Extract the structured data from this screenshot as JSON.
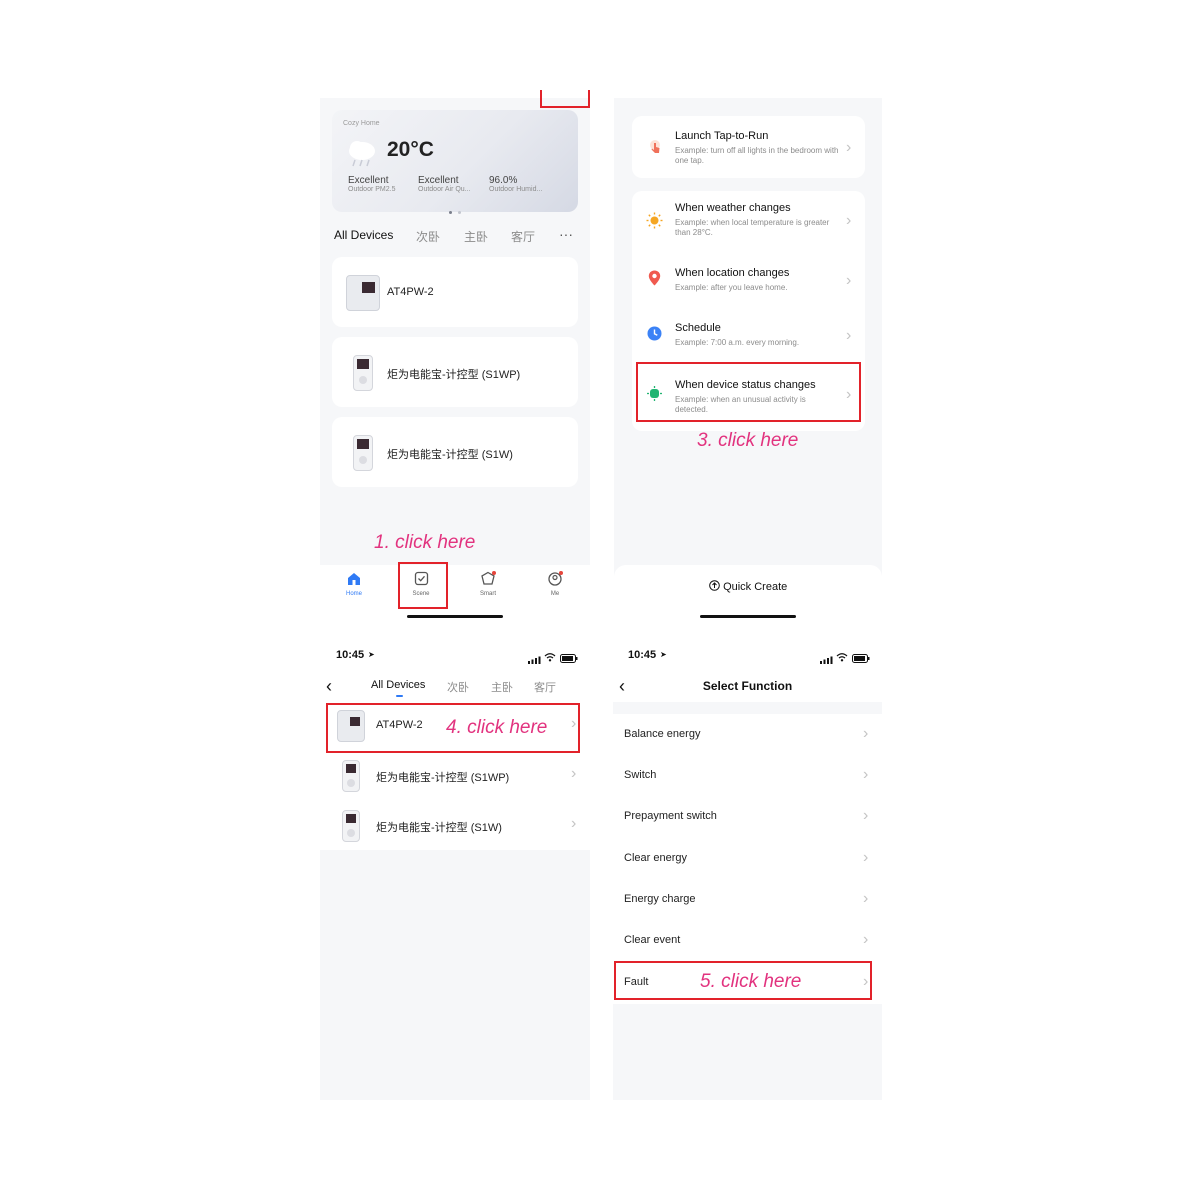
{
  "panel1": {
    "home_name": "Cozy Home",
    "temperature": "20°C",
    "stats": [
      {
        "value": "Excellent",
        "label": "Outdoor PM2.5"
      },
      {
        "value": "Excellent",
        "label": "Outdoor Air Qu..."
      },
      {
        "value": "96.0%",
        "label": "Outdoor Humid..."
      }
    ],
    "tabs": [
      "All Devices",
      "次卧",
      "主卧",
      "客厅"
    ],
    "more": "···",
    "devices": [
      "AT4PW-2",
      "炬为电能宝-计控型 (S1WP)",
      "炬为电能宝-计控型 (S1W)"
    ],
    "nav": [
      {
        "label": "Home",
        "icon": "home-icon"
      },
      {
        "label": "Scene",
        "icon": "scene-icon"
      },
      {
        "label": "Smart",
        "icon": "smart-icon"
      },
      {
        "label": "Me",
        "icon": "me-icon"
      }
    ],
    "annotation": "1. click here"
  },
  "panel2": {
    "launch": {
      "title": "Launch Tap-to-Run",
      "desc": "Example: turn off all lights in the bedroom with one tap.",
      "icon": "tap-icon"
    },
    "conditions": [
      {
        "title": "When weather changes",
        "desc": "Example: when local temperature is greater than 28°C.",
        "icon": "sun-icon",
        "color": "#f5a623"
      },
      {
        "title": "When location changes",
        "desc": "Example: after you leave home.",
        "icon": "location-pin-icon",
        "color": "#f05a4f"
      },
      {
        "title": "Schedule",
        "desc": "Example: 7:00 a.m. every morning.",
        "icon": "clock-icon",
        "color": "#3b82f6"
      },
      {
        "title": "When device status changes",
        "desc": "Example: when an unusual activity is detected.",
        "icon": "device-status-icon",
        "color": "#22b573"
      }
    ],
    "annotation": "3. click here",
    "quick_create": "Quick Create"
  },
  "panel3": {
    "time": "10:45",
    "tabs": [
      "All Devices",
      "次卧",
      "主卧",
      "客厅"
    ],
    "devices": [
      "AT4PW-2",
      "炬为电能宝-计控型 (S1WP)",
      "炬为电能宝-计控型 (S1W)"
    ],
    "annotation": "4. click here"
  },
  "panel4": {
    "time": "10:45",
    "title": "Select Function",
    "functions": [
      "Balance energy",
      "Switch",
      "Prepayment switch",
      "Clear energy",
      "Energy charge",
      "Clear event",
      "Fault"
    ],
    "annotation": "5. click here"
  },
  "colors": {
    "accent": "#2f7af5",
    "annotation": "#e2337f",
    "highlight_box": "#e2222a"
  }
}
